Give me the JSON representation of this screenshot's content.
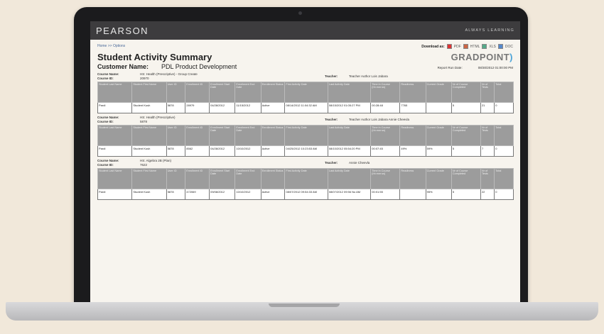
{
  "brand": {
    "logo": "PEARSON",
    "tagline": "ALWAYS LEARNING"
  },
  "nav": {
    "links": "Home >> Options"
  },
  "download": {
    "label": "Download as:",
    "formats": [
      "PDF",
      "HTML",
      "XLS",
      "DOC"
    ]
  },
  "report": {
    "title": "Student Activity Summary",
    "customer_label": "Customer Name:",
    "customer_value": "PDL Product Development",
    "run_date_label": "Report Run Date:",
    "run_date_value": "08/30/2012 01:00:00 PM",
    "logo": "GRADPOINT",
    "course_name_label": "Course Name:",
    "course_id_label": "Course ID:",
    "teacher_label": "Teacher:"
  },
  "columns": [
    "Student Last Name",
    "Student First Name",
    "User ID",
    "Enrollment ID",
    "Enrollment Start Date",
    "Enrollment End Date",
    "Enrollment Status",
    "First Activity Date",
    "Last Activity Date",
    "Time in Course (hh:mm:ss)",
    "Readiness",
    "Current Grade",
    "Nr of Course Completed",
    "Nr of Tests",
    "Total"
  ],
  "courses": [
    {
      "name": "HS: Health (Prescriptive) - Group Create",
      "id": "20970",
      "teacher": "Teacher Author Lois Jabara",
      "row": [
        "Pardi",
        "Student Kush",
        "5878",
        "28979",
        "04/28/2012",
        "11/15/2012",
        "Active",
        "08/14/2012 11:04:32 AM",
        "08/15/2012 01:05:27 PM",
        "00:28:48",
        "7765",
        "",
        "5",
        "21",
        "0"
      ]
    },
    {
      "name": "HS: Health (Prescriptive)",
      "id": "5878",
      "teacher": "Teacher Author Lois Jabara Annie Cheevla",
      "row": [
        "Pardi",
        "Student Kush",
        "5878",
        "8562",
        "04/28/2012",
        "10/10/2012",
        "Active",
        "04/25/2012 10:23:53 AM",
        "08/10/2012 05:54:20 PM",
        "00:07:45",
        "49%",
        "59%",
        "5",
        "7",
        "0"
      ]
    },
    {
      "name": "HS: Algebra 2B (Plan)",
      "id": "7622",
      "teacher": "Annie Cheevla",
      "row": [
        "Pardi",
        "Student Kush",
        "5878",
        "472069",
        "09/08/2012",
        "10/10/2012",
        "Active",
        "08/07/2012 09:54:33 AM",
        "08/07/2012 09:56 No AM",
        "00:01:55",
        "",
        "95%",
        "5",
        "22",
        "0"
      ]
    }
  ]
}
